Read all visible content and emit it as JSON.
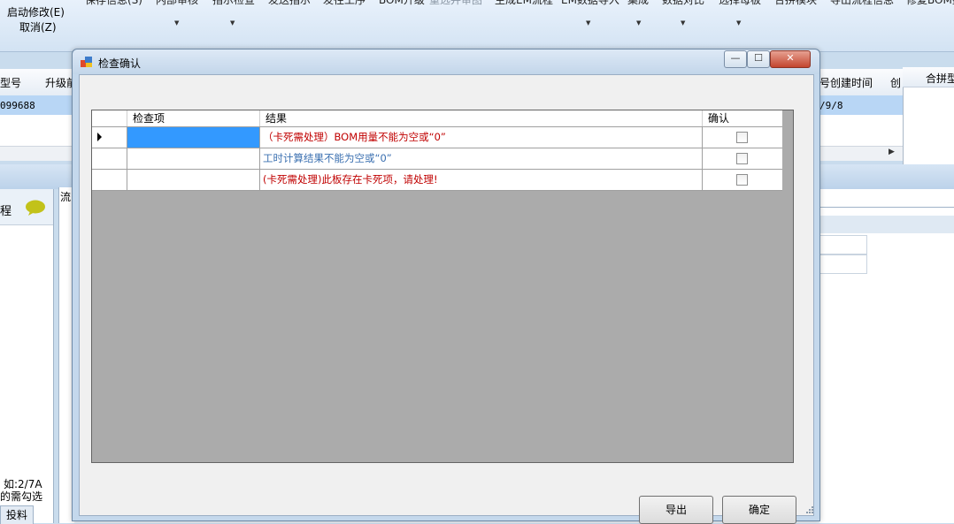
{
  "background_app": {
    "toolbar_left": [
      "启动修改(E)",
      "取消(Z)"
    ],
    "toolbar_items": [
      "保存信息(S)",
      "内部审核",
      "指示检查",
      "发送指示",
      "发往工序",
      "BOM升级",
      "重选并审图",
      "生成EM流程",
      "EM数据导入",
      "集成",
      "数据对比",
      "选择母板",
      "合拼模块",
      "导出流程信息",
      "修复BOM数"
    ],
    "grid_columns": [
      "型号",
      "升级前",
      "号创建时间",
      "创"
    ],
    "grid_row_values": [
      "099688",
      "/9/8"
    ],
    "right_panel_title": "合拼型",
    "left_pane_label": "程",
    "mid_pane_label": "流",
    "left_hint_line1": "如:2/7A",
    "left_hint_line2": "的需勾选",
    "left_tab": "投料"
  },
  "dialog": {
    "title": "检查确认",
    "columns": {
      "check_item": "检查项",
      "result": "结果",
      "confirm": "确认"
    },
    "rows": [
      {
        "item": "",
        "result": "（卡死需处理）BOM用量不能为空或“0”",
        "result_color": "#c00000",
        "confirmed": false,
        "selected": true
      },
      {
        "item": "",
        "result": "工时计算结果不能为空或“0”",
        "result_color": "#3a6fb0",
        "confirmed": false,
        "selected": false
      },
      {
        "item": "",
        "result": "(卡死需处理)此板存在卡死项，请处理!",
        "result_color": "#c00000",
        "confirmed": false,
        "selected": false
      }
    ],
    "buttons": {
      "export": "导出",
      "ok": "确定"
    },
    "window_controls": {
      "minimize": "—",
      "maximize": "☐",
      "close": "✕"
    }
  },
  "colors": {
    "grid_empty_area": "#ababab",
    "selection": "#3399ff",
    "error_text": "#c00000",
    "info_text": "#3a6fb0"
  }
}
